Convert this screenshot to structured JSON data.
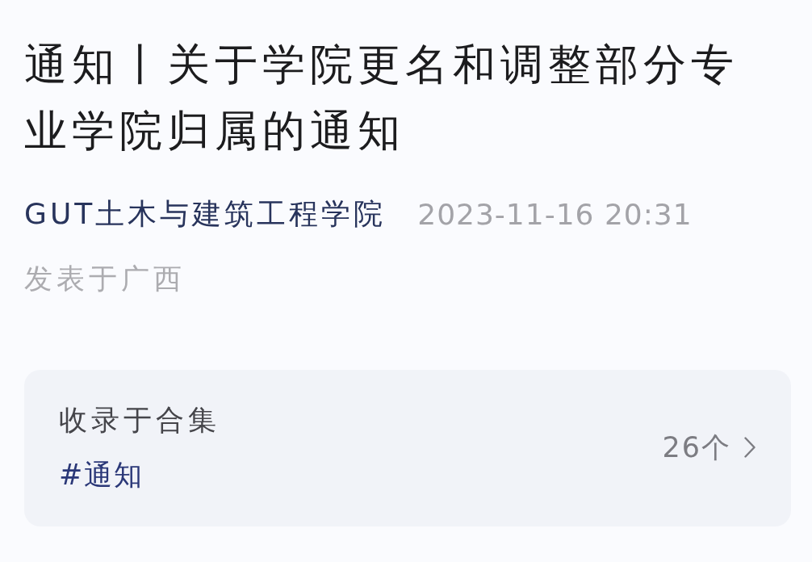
{
  "article": {
    "title": "通知丨关于学院更名和调整部分专业学院归属的通知",
    "author": "GUT土木与建筑工程学院",
    "published_at": "2023-11-16 20:31",
    "location": "发表于广西"
  },
  "collection": {
    "heading": "收录于合集",
    "tag": "#通知",
    "count": "26个"
  }
}
